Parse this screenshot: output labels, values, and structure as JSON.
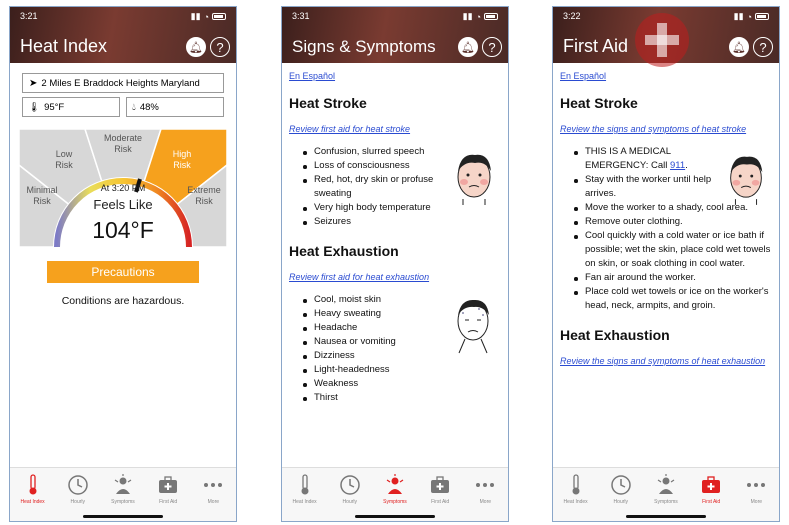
{
  "screens": [
    {
      "status_time": "3:21",
      "title": "Heat Index",
      "location": "2 Miles E Braddock Heights Maryland",
      "temperature": "95°F",
      "humidity": "48%",
      "risk_levels": [
        "Minimal Risk",
        "Low Risk",
        "Moderate Risk",
        "High Risk",
        "Extreme Risk"
      ],
      "active_risk": "High Risk",
      "time_label": "At 3:20 PM",
      "feels_like_label": "Feels Like",
      "feels_like_value": "104°F",
      "precautions_button": "Precautions",
      "conditions_text": "Conditions are hazardous."
    },
    {
      "status_time": "3:31",
      "title": "Signs & Symptoms",
      "espanol_link": "En Español",
      "sections": [
        {
          "heading": "Heat Stroke",
          "review_link": "Review first aid for heat stroke",
          "items": [
            "Confusion, slurred speech",
            "Loss of consciousness",
            "Red, hot, dry skin or profuse sweating",
            "Very high body temperature",
            "Seizures"
          ]
        },
        {
          "heading": "Heat Exhaustion",
          "review_link": "Review first aid for heat exhaustion",
          "items": [
            "Cool, moist skin",
            "Heavy sweating",
            "Headache",
            "Nausea or vomiting",
            "Dizziness",
            "Light-headedness",
            "Weakness",
            "Thirst"
          ]
        }
      ]
    },
    {
      "status_time": "3:22",
      "title": "First Aid",
      "espanol_link": "En Español",
      "sections": [
        {
          "heading": "Heat Stroke",
          "review_link": "Review the signs and symptoms of heat stroke",
          "emergency_text": "THIS IS A MEDICAL EMERGENCY: Call",
          "emergency_number": "911",
          "items": [
            "Stay with the worker until help arrives.",
            "Move the worker to a shady, cool area.",
            "Remove outer clothing.",
            "Cool quickly with a cold water or ice bath if possible; wet the skin, place cold wet towels on skin, or soak clothing in cool water.",
            "Fan air around the worker.",
            "Place cold wet towels or ice on the worker's head, neck, armpits, and groin."
          ]
        },
        {
          "heading": "Heat Exhaustion",
          "review_link": "Review the signs and symptoms of heat exhaustion"
        }
      ]
    }
  ],
  "tabs": [
    {
      "label": "Heat Index",
      "icon": "thermometer-icon"
    },
    {
      "label": "Hourly",
      "icon": "clock-icon"
    },
    {
      "label": "Symptoms",
      "icon": "person-alert-icon"
    },
    {
      "label": "First Aid",
      "icon": "first-aid-kit-icon"
    },
    {
      "label": "More",
      "icon": "more-dots-icon"
    }
  ],
  "active_tabs": [
    0,
    2,
    3
  ],
  "colors": {
    "accent": "#f6a11d",
    "active_tab": "#e02020",
    "link": "#2a4bd1",
    "header": "#6a352d"
  }
}
